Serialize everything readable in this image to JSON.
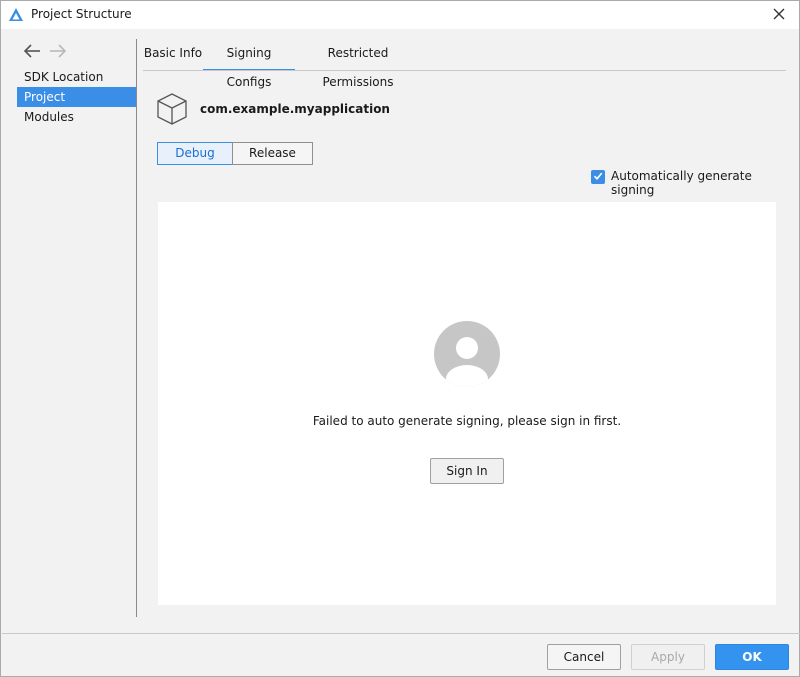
{
  "window": {
    "title": "Project Structure"
  },
  "sidebar": {
    "items": [
      {
        "label": "SDK Location",
        "active": false
      },
      {
        "label": "Project",
        "active": true
      },
      {
        "label": "Modules",
        "active": false
      }
    ]
  },
  "tabs": [
    {
      "label": "Basic Info",
      "active": false
    },
    {
      "label": "Signing Configs",
      "active": true
    },
    {
      "label": "Restricted Permissions",
      "active": false
    }
  ],
  "module": {
    "name": "com.example.myapplication",
    "icon": "cube-icon"
  },
  "build_types": {
    "debug": "Debug",
    "release": "Release",
    "selected": "Debug"
  },
  "auto_signing": {
    "label": "Automatically generate signing",
    "checked": true
  },
  "panel": {
    "message": "Failed to auto generate signing, please sign in first.",
    "signin_label": "Sign In",
    "avatar_icon": "user-avatar-icon"
  },
  "footer": {
    "cancel": "Cancel",
    "apply": "Apply",
    "ok": "OK"
  },
  "colors": {
    "accent": "#3a8ee6",
    "ok_button": "#3593f0",
    "avatar": "#c6c6c6"
  }
}
